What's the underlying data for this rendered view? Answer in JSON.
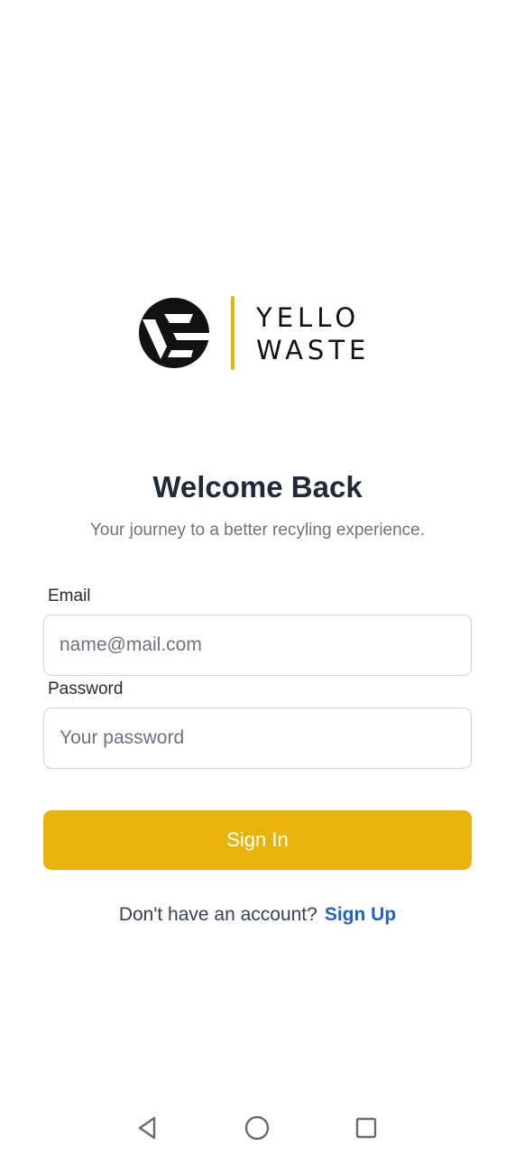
{
  "brand": {
    "name_line1": "YELLO",
    "name_line2": "WASTE",
    "logo_icon": "yellowaste-logo-mark",
    "accent_color": "#e2b40d"
  },
  "login": {
    "title": "Welcome Back",
    "subtitle": "Your journey to a better recyling experience.",
    "email": {
      "label": "Email",
      "placeholder": "name@mail.com",
      "value": ""
    },
    "password": {
      "label": "Password",
      "placeholder": "Your password",
      "value": ""
    },
    "signin_label": "Sign In",
    "signin_color": "#e8b30c",
    "signup_prompt": "Don't have an account?",
    "signup_link": "Sign Up",
    "signup_color": "#2563b8"
  },
  "nav_bar": {
    "back_icon": "triangle-back-icon",
    "home_icon": "circle-home-icon",
    "recent_icon": "square-recents-icon"
  }
}
